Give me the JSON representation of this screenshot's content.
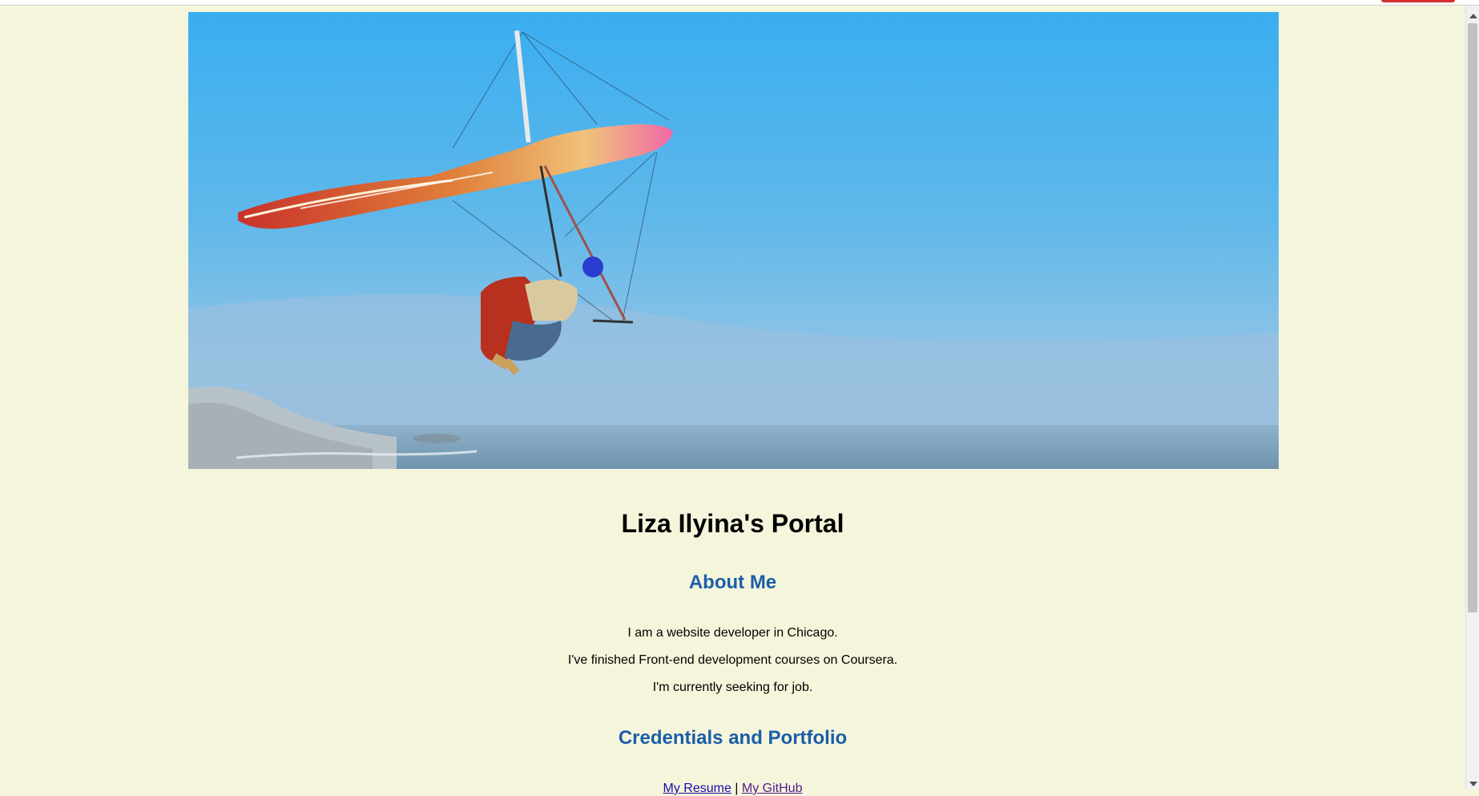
{
  "hero_image": {
    "description_icon": "hang-glider-photo-icon"
  },
  "page_title": "Liza Ilyina's Portal",
  "about": {
    "heading": "About Me",
    "lines": [
      "I am a website developer in Chicago.",
      "I've finished Front-end development courses on Coursera.",
      "I'm currently seeking for job."
    ]
  },
  "credentials": {
    "heading": "Credentials and Portfolio",
    "links": [
      {
        "label": "My Resume"
      },
      {
        "label": "My GitHub"
      }
    ],
    "separator": " | "
  },
  "colors": {
    "background": "#f5f5dc",
    "heading": "#1a5ea8",
    "link": "#1a0dab",
    "visited_link": "#551a8b"
  }
}
